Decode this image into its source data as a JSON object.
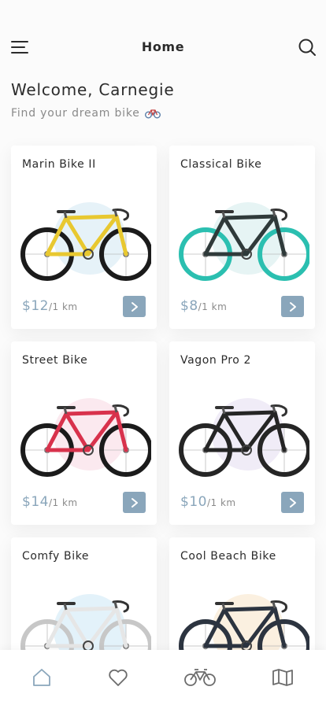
{
  "header": {
    "title": "Home"
  },
  "welcome": {
    "title": "Welcome, Carnegie",
    "subtitle": "Find your dream bike"
  },
  "colors": {
    "accent": "#8aa6bb",
    "text": "#2b2b2b",
    "muted": "#8a8a8a"
  },
  "bikes": [
    {
      "name": "Marin Bike II",
      "price": "$12",
      "unit": "/1 km",
      "frame_color": "#e8c830",
      "wheel_color": "#1b1b1b",
      "blob_color": "#e6f2f8"
    },
    {
      "name": "Classical Bike",
      "price": "$8",
      "unit": "/1 km",
      "frame_color": "#2f3a3a",
      "wheel_color": "#2bbfb0",
      "blob_color": "#e6f4f4"
    },
    {
      "name": "Street Bike",
      "price": "$14",
      "unit": "/1 km",
      "frame_color": "#d8324c",
      "wheel_color": "#1b1b1b",
      "blob_color": "#fbe9ef"
    },
    {
      "name": "Vagon Pro 2",
      "price": "$10",
      "unit": "/1 km",
      "frame_color": "#252525",
      "wheel_color": "#252525",
      "blob_color": "#f0ecf7"
    },
    {
      "name": "Comfy Bike",
      "price": "",
      "unit": "",
      "frame_color": "#e6e6e6",
      "wheel_color": "#c7c7c7",
      "blob_color": "#e3f2fa"
    },
    {
      "name": "Cool Beach Bike",
      "price": "",
      "unit": "",
      "frame_color": "#2c3440",
      "wheel_color": "#2c3440",
      "blob_color": "#fbf0e0"
    }
  ],
  "tabbar": {
    "items": [
      "home-icon",
      "heart-icon",
      "bike-icon",
      "map-icon"
    ]
  }
}
